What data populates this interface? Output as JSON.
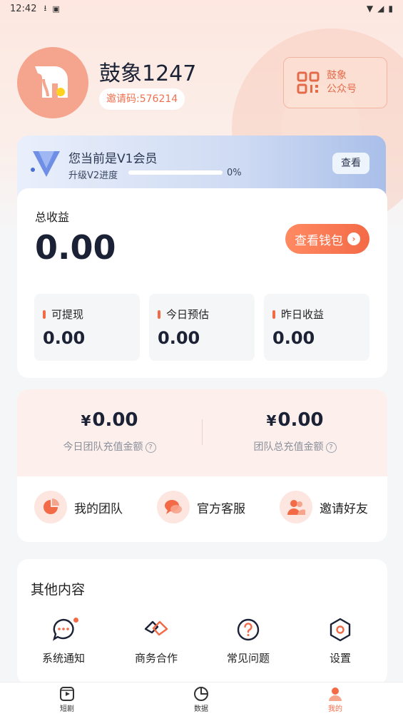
{
  "status_bar": {
    "time": "12:42"
  },
  "profile": {
    "name": "鼓象1247",
    "invite_code": "邀请码:576214"
  },
  "official_account": {
    "label_line1": "鼓象",
    "label_line2": "公众号"
  },
  "vip": {
    "title": "您当前是V1会员",
    "progress_label": "升级V2进度",
    "progress": 0,
    "progress_text": "0%",
    "view_label": "查看"
  },
  "earnings": {
    "total_label": "总收益",
    "total_value": "0.00",
    "wallet_label": "查看钱包",
    "items": [
      {
        "label": "可提现",
        "value": "0.00"
      },
      {
        "label": "今日预估",
        "value": "0.00"
      },
      {
        "label": "昨日收益",
        "value": "0.00"
      }
    ]
  },
  "team": {
    "stats": [
      {
        "currency": "¥",
        "value": "0.00",
        "label": "今日团队充值金额"
      },
      {
        "currency": "¥",
        "value": "0.00",
        "label": "团队总充值金额"
      }
    ],
    "help_glyph": "?",
    "actions": [
      {
        "label": "我的团队",
        "icon": "pie-chart-icon"
      },
      {
        "label": "官方客服",
        "icon": "chat-bubbles-icon"
      },
      {
        "label": "邀请好友",
        "icon": "users-icon"
      }
    ]
  },
  "other": {
    "title": "其他内容",
    "items": [
      {
        "label": "系统通知",
        "icon": "message-icon"
      },
      {
        "label": "商务合作",
        "icon": "handshake-icon"
      },
      {
        "label": "常见问题",
        "icon": "question-icon"
      },
      {
        "label": "设置",
        "icon": "settings-hexagon-icon"
      }
    ]
  },
  "tabs": [
    {
      "label": "短剧",
      "icon": "video-icon"
    },
    {
      "label": "数据",
      "icon": "pie-icon"
    },
    {
      "label": "我的",
      "icon": "person-icon",
      "active": true
    }
  ],
  "colors": {
    "accent": "#f36a46",
    "text_dark": "#1c2235",
    "vip_blue": "#5b7fdc"
  }
}
